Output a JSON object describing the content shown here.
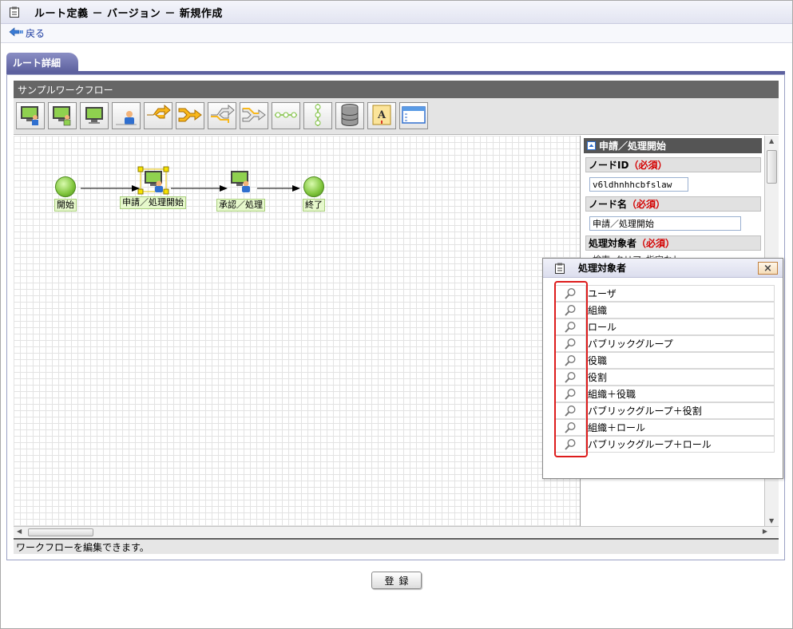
{
  "page": {
    "title": "ルート定義 － バージョン － 新規作成",
    "back_label": "戻る",
    "tab_label": "ルート詳細",
    "submit_label": "登録"
  },
  "workflow": {
    "header": "サンプルワークフロー",
    "status_text": "ワークフローを編集できます。",
    "toolbar_icons": [
      "process-node-icon",
      "approval-node-icon",
      "monitor-node-icon",
      "user-node-icon",
      "branch-icon",
      "merge-icon",
      "split-icon",
      "join-icon",
      "line-icon",
      "vertical-line-icon",
      "database-icon",
      "text-icon",
      "window-icon"
    ],
    "nodes": [
      {
        "label": "開始",
        "type": "start"
      },
      {
        "label": "申請／処理開始",
        "type": "apply"
      },
      {
        "label": "承認／処理",
        "type": "approve"
      },
      {
        "label": "終了",
        "type": "end"
      }
    ]
  },
  "properties": {
    "title": "申請／処理開始",
    "node_id_label": "ノードID",
    "node_id_value": "v6ldhnhhcbfslaw",
    "node_name_label": "ノード名",
    "node_name_value": "申請／処理開始",
    "required_text": "（必須）",
    "target_label": "処理対象者",
    "target_actions": [
      "検索",
      "クリア",
      "指定なし"
    ]
  },
  "popup": {
    "title": "処理対象者",
    "close_label": "×",
    "items": [
      "ユーザ",
      "組織",
      "ロール",
      "パブリックグループ",
      "役職",
      "役割",
      "組織＋役職",
      "パブリックグループ＋役割",
      "組織＋ロール",
      "パブリックグループ＋ロール"
    ]
  },
  "colors": {
    "tab": "#5d619f",
    "grid_line": "#e3e3e3",
    "node_green": "#7ec43a",
    "required_red": "#d40000",
    "highlight_red": "#dd1c1c"
  }
}
